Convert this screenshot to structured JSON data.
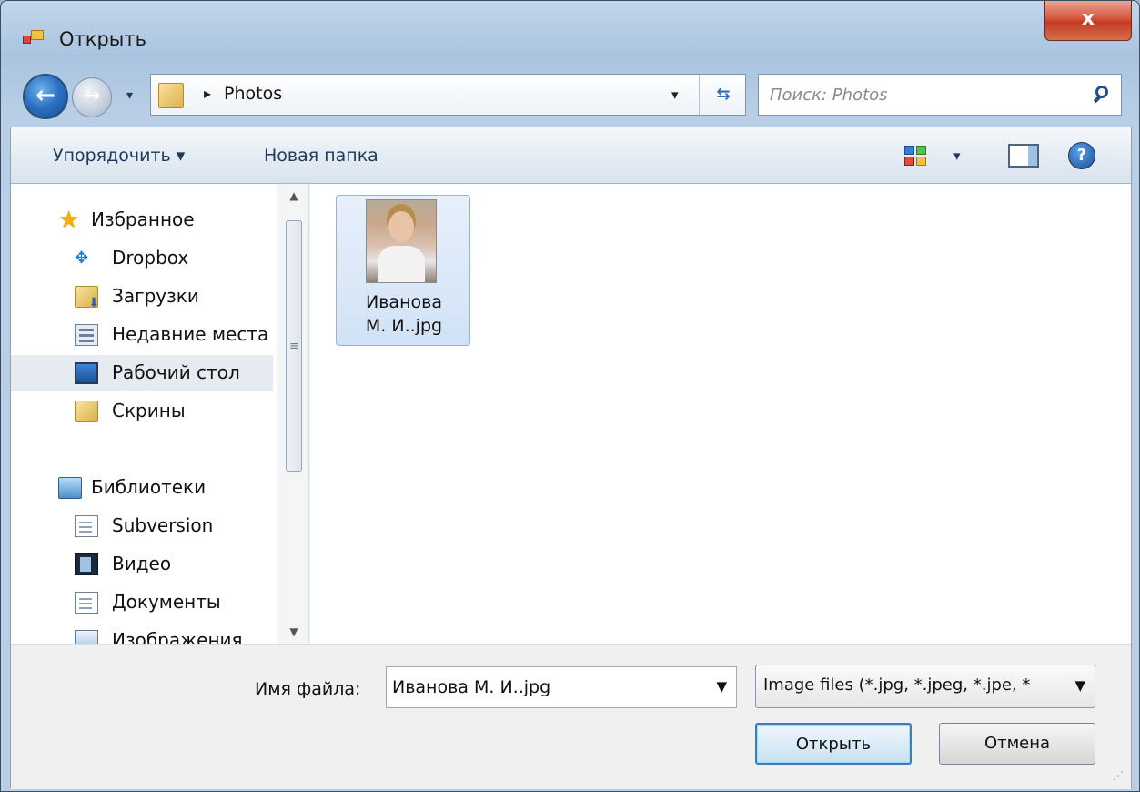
{
  "window": {
    "title": "Открыть",
    "close_glyph": "x"
  },
  "nav": {
    "back_glyph": "←",
    "forward_glyph": "→",
    "history_glyph": "▾",
    "address": {
      "separator": "▸",
      "folder": "Photos",
      "dropdown_glyph": "▾",
      "refresh_glyph": "⇆"
    },
    "search": {
      "placeholder": "Поиск: Photos"
    }
  },
  "toolbar": {
    "organize_label": "Упорядочить ▾",
    "new_folder_label": "Новая папка",
    "views_dropdown_glyph": "▾",
    "help_glyph": "?"
  },
  "sidebar": {
    "favorites": {
      "label": "Избранное",
      "items": [
        {
          "label": "Dropbox",
          "icon": "dropbox-icon"
        },
        {
          "label": "Загрузки",
          "icon": "downloads-folder-icon"
        },
        {
          "label": "Недавние места",
          "icon": "recent-places-icon"
        },
        {
          "label": "Рабочий стол",
          "icon": "desktop-icon",
          "selected": true
        },
        {
          "label": "Скрины",
          "icon": "folder-icon"
        }
      ]
    },
    "libraries": {
      "label": "Библиотеки",
      "items": [
        {
          "label": "Subversion",
          "icon": "document-icon"
        },
        {
          "label": "Видео",
          "icon": "video-icon"
        },
        {
          "label": "Документы",
          "icon": "documents-icon"
        },
        {
          "label": "Изображения",
          "icon": "pictures-icon"
        }
      ]
    },
    "scroll": {
      "up_glyph": "▲",
      "down_glyph": "▼",
      "grip_glyph": "≡"
    }
  },
  "files": [
    {
      "name_line1": "Иванова",
      "name_line2": "М. И..jpg",
      "selected": true
    }
  ],
  "footer": {
    "filename_label": "Имя файла:",
    "filename_value": "Иванова М. И..jpg",
    "filename_dropdown_glyph": "▼",
    "file_type": "Image files (*.jpg, *.jpeg, *.jpe, *",
    "file_type_dropdown_glyph": "▼",
    "open_label": "Открыть",
    "cancel_label": "Отмена",
    "grip_glyph": "⋰"
  },
  "colors": {
    "accent": "#3c7fb1",
    "close_red": "#c23b22",
    "selection": "#d1e2f6"
  }
}
